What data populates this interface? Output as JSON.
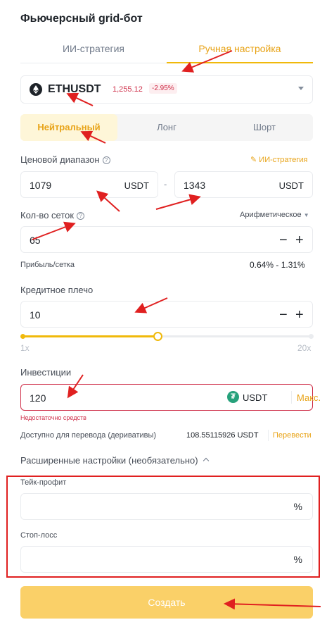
{
  "title": "Фьючерсный grid-бот",
  "tabs": [
    {
      "label": "ИИ-стратегия",
      "active": false
    },
    {
      "label": "Ручная настройка",
      "active": true
    }
  ],
  "pair": {
    "name": "ETHUSDT",
    "price": "1,255.12",
    "change": "-2.95%",
    "icon": "ethereum-icon"
  },
  "modes": [
    {
      "label": "Нейтральный",
      "active": true
    },
    {
      "label": "Лонг",
      "active": false
    },
    {
      "label": "Шорт",
      "active": false
    }
  ],
  "price_range": {
    "label": "Ценовой диапазон",
    "ai_link": "ИИ-стратегия",
    "low": "1079",
    "high": "1343",
    "unit": "USDT",
    "separator": "-"
  },
  "grids": {
    "label": "Кол-во сеток",
    "mode": "Арифметическое",
    "value": "65",
    "minus": "−",
    "plus": "+"
  },
  "profit": {
    "label": "Прибыль/сетка",
    "value": "0.64% - 1.31%"
  },
  "leverage": {
    "label": "Кредитное плечо",
    "value": "10",
    "minus": "−",
    "plus": "+",
    "min_label": "1x",
    "max_label": "20x",
    "slider_fraction": 0.47
  },
  "investment": {
    "label": "Инвестиции",
    "value": "120",
    "unit": "USDT",
    "token_symbol": "₮",
    "max_label": "Макс.",
    "error": "Недостаточно средств"
  },
  "available": {
    "label": "Доступно для перевода (деривативы)",
    "value": "108.55115926 USDT",
    "transfer": "Перевести"
  },
  "advanced": {
    "label": "Расширенные настройки (необязательно)",
    "take_profit": {
      "label": "Тейк-профит",
      "unit": "%"
    },
    "stop_loss": {
      "label": "Стоп-лосс",
      "unit": "%"
    }
  },
  "create_button": "Создать",
  "colors": {
    "accent": "#f0b90b",
    "accent_text": "#e8a317",
    "error": "#cf304a",
    "annotation": "#e02020",
    "button_disabled": "#fad068"
  }
}
